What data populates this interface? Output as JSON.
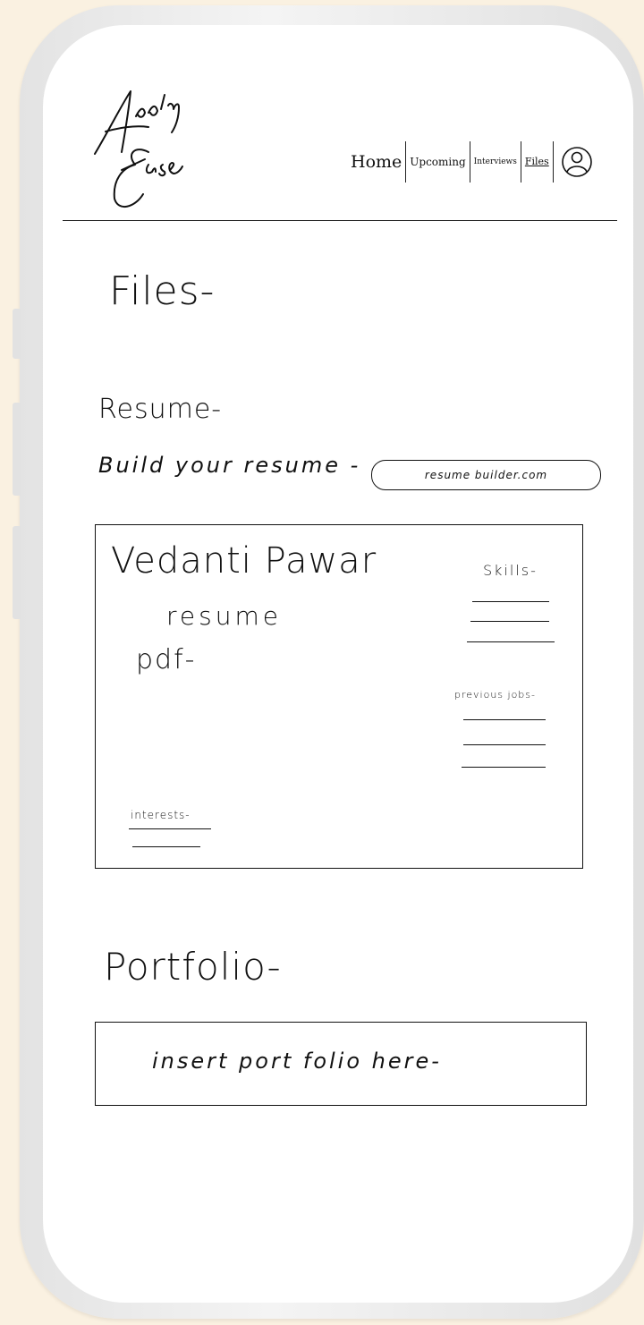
{
  "app": {
    "logo_text": "Apply Ease"
  },
  "nav": {
    "items": [
      {
        "label": "Home"
      },
      {
        "label": "Upcoming"
      },
      {
        "label": "Interviews"
      },
      {
        "label": "Files",
        "active": true
      }
    ],
    "profile_icon": "user-circle-icon"
  },
  "page": {
    "title": "Files-"
  },
  "resume_section": {
    "heading": "Resume-",
    "build_label": "Build your resume -",
    "builder_link": "resume builder.com",
    "preview": {
      "name": "Vedanti Pawar",
      "subtitle": "resume",
      "format_label": "pdf-",
      "skills_label": "Skills-",
      "previous_jobs_label": "previous jobs-",
      "interests_label": "interests-"
    }
  },
  "portfolio_section": {
    "heading": "Portfolio-",
    "placeholder": "insert port folio here-"
  },
  "colors": {
    "background": "#FAF1E1",
    "screen": "#FFFFFF",
    "ink": "#111111",
    "frame": "#E6E6E6"
  }
}
